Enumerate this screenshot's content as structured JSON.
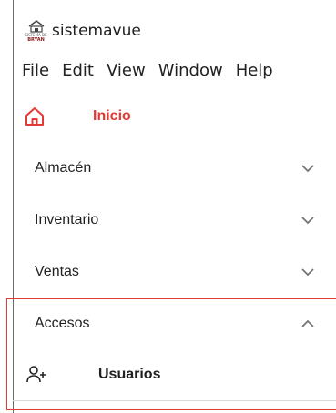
{
  "window": {
    "title": "sistemavue",
    "logo_text_top": "SISTEMA DE",
    "logo_text_bottom": "BRYAN"
  },
  "menubar": {
    "items": [
      "File",
      "Edit",
      "View",
      "Window",
      "Help"
    ]
  },
  "nav": {
    "home": {
      "label": "Inicio",
      "icon": "home-icon"
    },
    "groups": [
      {
        "label": "Almacén",
        "expanded": false
      },
      {
        "label": "Inventario",
        "expanded": false
      },
      {
        "label": "Ventas",
        "expanded": false
      },
      {
        "label": "Accesos",
        "expanded": true
      }
    ],
    "accesos_children": [
      {
        "label": "Usuarios",
        "icon": "add-user-icon"
      }
    ]
  },
  "colors": {
    "accent": "#e53935",
    "text": "#212121",
    "chevron": "#757575"
  }
}
